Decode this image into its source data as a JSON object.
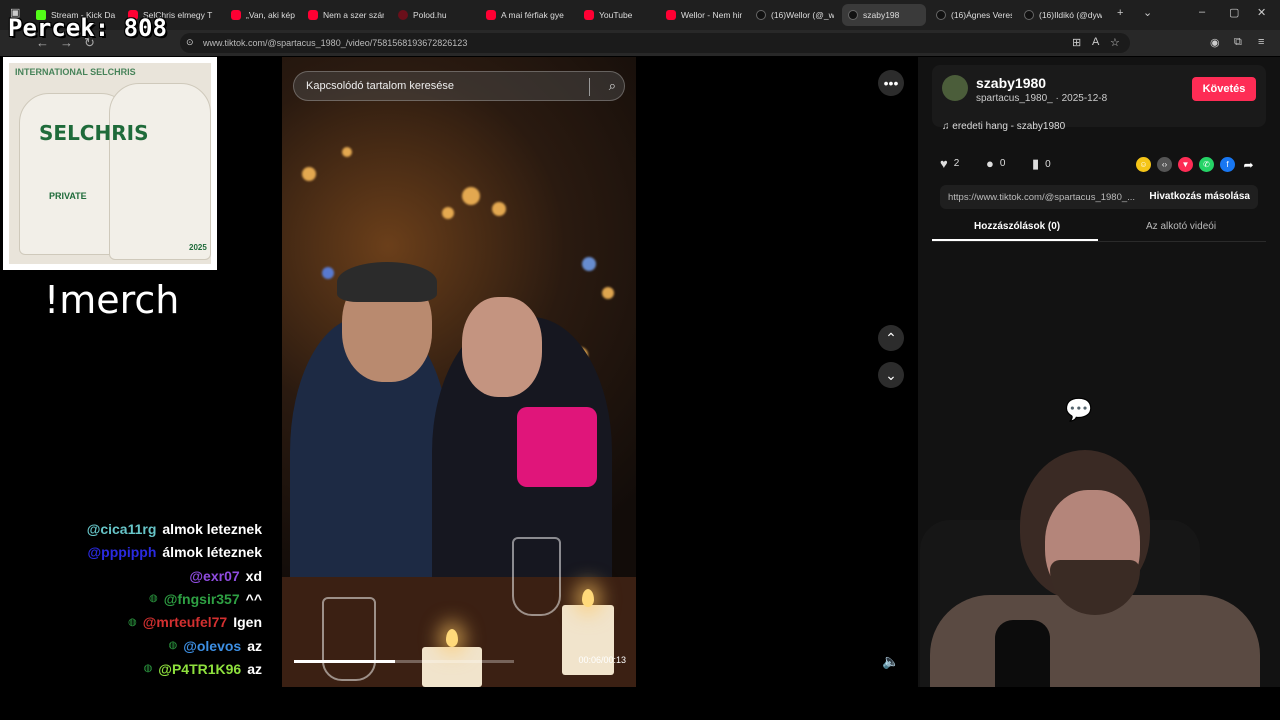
{
  "overlay": {
    "counter": "Percek:  808",
    "merch_command": "!merch"
  },
  "merch": {
    "brand": "SELCHRIS",
    "top_text": "INTERNATIONAL SELCHRIS",
    "tag": "PRIVATE",
    "year": "2025"
  },
  "browser": {
    "tabs": [
      {
        "label": "Stream - Kick Da",
        "icon": "kick"
      },
      {
        "label": "SelChris elmegy T",
        "icon": "yt"
      },
      {
        "label": "„Van, aki képes el",
        "icon": "yt"
      },
      {
        "label": "Nem a szer szám",
        "icon": "yt"
      },
      {
        "label": "Polod.hu",
        "icon": "polod"
      },
      {
        "label": "A mai férfiak gye",
        "icon": "yt"
      },
      {
        "label": "YouTube",
        "icon": "yt"
      },
      {
        "label": "Wellor - Nem hin",
        "icon": "yt"
      },
      {
        "label": "(16)Wellor (@_we",
        "icon": "tt"
      },
      {
        "label": "szaby198",
        "icon": "tt",
        "active": true
      },
      {
        "label": "(16)Ágnes Veress",
        "icon": "tt"
      },
      {
        "label": "(16)Ildikó (@dyw",
        "icon": "tt"
      }
    ],
    "url": "www.tiktok.com/@spartacus_1980_/video/7581568193672826123"
  },
  "chat": [
    {
      "user": "@cica11rg",
      "color": "#67c5c8",
      "message": "almok leteznek",
      "badge": false
    },
    {
      "user": "@pppipph",
      "color": "#2a2ae0",
      "message": "álmok léteznek",
      "badge": false
    },
    {
      "user": "@exr07",
      "color": "#8f4ce0",
      "message": "xd",
      "badge": false
    },
    {
      "user": "@fngsir357",
      "color": "#2ea043",
      "message": "^^",
      "badge": true
    },
    {
      "user": "@mrteufel77",
      "color": "#d33030",
      "message": "Igen",
      "badge": true
    },
    {
      "user": "@olevos",
      "color": "#3d8fe3",
      "message": "az",
      "badge": true
    },
    {
      "user": "@P4TR1K96",
      "color": "#8ee03d",
      "message": "az",
      "badge": true
    }
  ],
  "video": {
    "search_placeholder": "Kapcsolódó tartalom keresése",
    "time": "00:06/00:13",
    "progress": 0.46
  },
  "panel": {
    "author_name": "szaby1980",
    "author_sub": "spartacus_1980_ · 2025-12-8",
    "follow_label": "Követés",
    "music": "eredeti hang - szaby1980",
    "likes": "2",
    "comments": "0",
    "saves": "0",
    "link": "https://www.tiktok.com/@spartacus_1980_...",
    "copy_label": "Hivatkozás másolása",
    "tab_comments": "Hozzászólások (0)",
    "tab_creator": "Az alkotó videói",
    "share_colors": [
      "#f5c518",
      "#555555",
      "#fe2c55",
      "#25d366",
      "#1877f2"
    ]
  }
}
